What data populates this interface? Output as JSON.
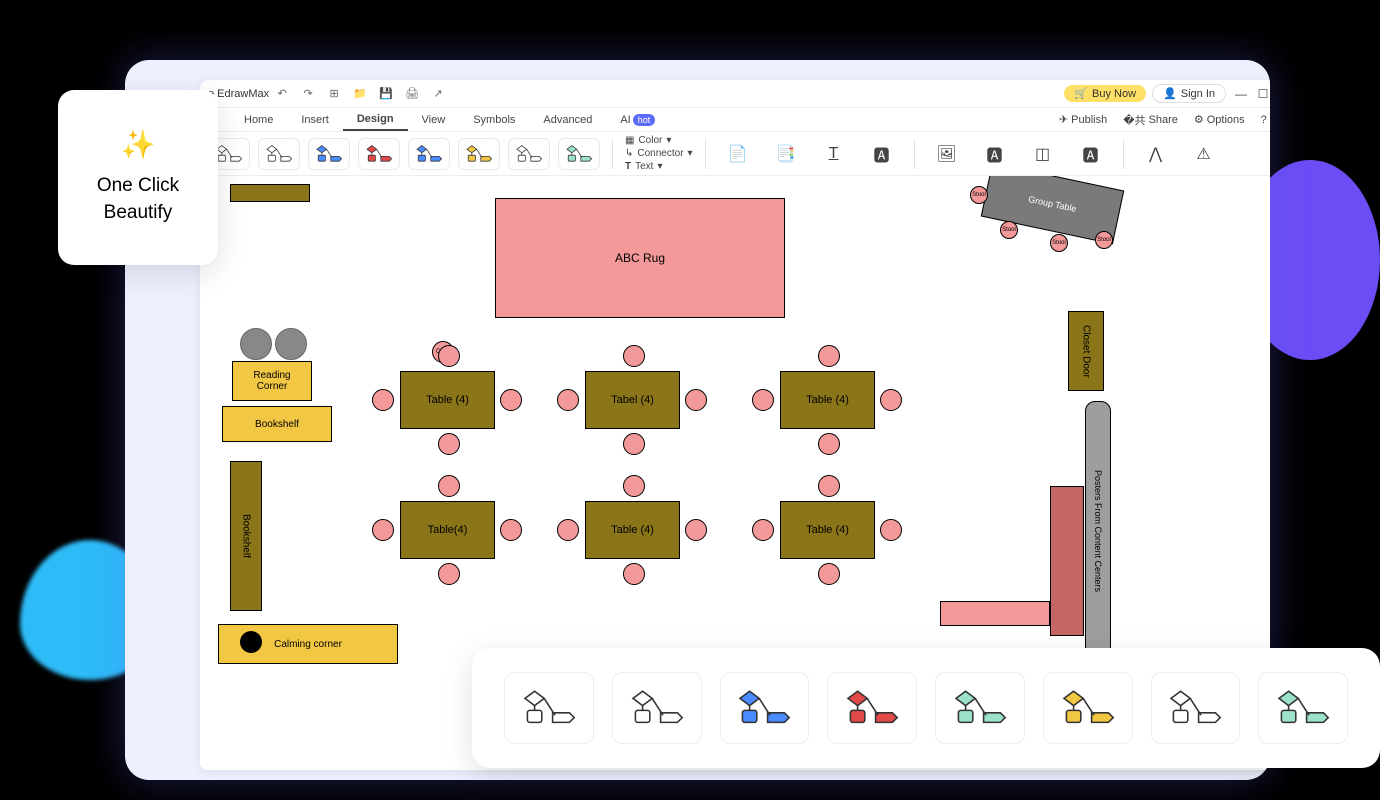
{
  "app_title": "e EdrawMax",
  "titlebar": {
    "buy_now": "Buy Now",
    "sign_in": "Sign In"
  },
  "menu": {
    "home": "Home",
    "insert": "Insert",
    "design": "Design",
    "view": "View",
    "symbols": "Symbols",
    "advanced": "Advanced",
    "ai": "AI",
    "hot": "hot",
    "publish": "Publish",
    "share": "Share",
    "options": "Options"
  },
  "ribbon": {
    "color": "Color",
    "connector": "Connector",
    "text": "Text"
  },
  "canvas": {
    "rug": "ABC Rug",
    "chair": "Chair",
    "table4": "Table (4)",
    "tabel4": "Tabel (4)",
    "table4b": "Table(4)",
    "reading_corner": "Reading\nCorner",
    "bookshelf": "Bookshelf",
    "bookshelf_v": "Bookshelf",
    "calming": "Calming corner",
    "closet": "Closet Door",
    "posters": "Posters From Content Centers",
    "group_table": "Group Table",
    "stool": "Stool"
  },
  "beautify": {
    "line1": "One Click",
    "line2": "Beautify"
  },
  "theme_colors": [
    "#ffffff",
    "#ffffff",
    "#4a8cff",
    "#e24a4a",
    "#4a8cff",
    "#f2c744",
    "#ffffff",
    "#9be2c8"
  ],
  "dock_colors": [
    "#ffffff",
    "#ffffff",
    "#4a8cff",
    "#e24a4a",
    "#9be2c8",
    "#f2c744",
    "#ffffff",
    "#9be2c8"
  ]
}
